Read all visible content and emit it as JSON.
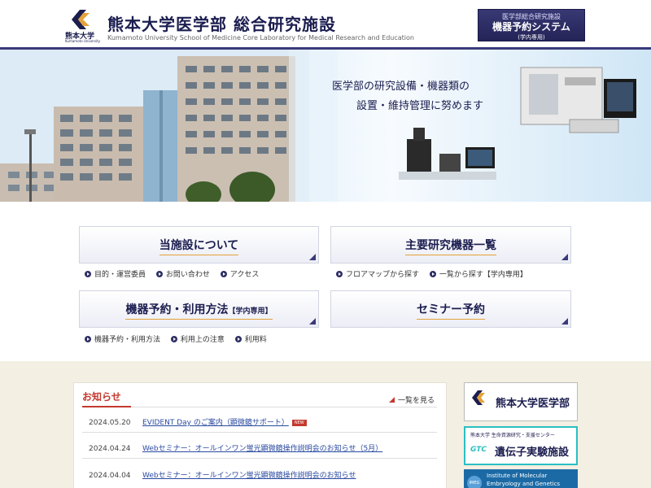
{
  "header": {
    "logo_text": "熊本大学",
    "logo_sub": "Kumamoto University",
    "title_main": "熊本大学医学部",
    "title_strong": "総合研究施設",
    "subtitle": "Kumamoto University School of Medicine Core Laboratory for Medical Research and Education",
    "reserve": {
      "line1": "医学部総合研究施設",
      "line2": "機器予約システム",
      "line3": "(学内専用)"
    }
  },
  "hero": {
    "line1": "医学部の研究設備・機器類の",
    "line2": "設置・維持管理に努めます"
  },
  "panels": [
    {
      "title": "当施設について",
      "tag": "",
      "links": [
        "目的・運営委員",
        "お問い合わせ",
        "アクセス"
      ]
    },
    {
      "title": "主要研究機器一覧",
      "tag": "",
      "links": [
        "フロアマップから探す",
        "一覧から探す【学内専用】"
      ]
    },
    {
      "title": "機器予約・利用方法",
      "tag": "【学内専用】",
      "links": [
        "機器予約・利用方法",
        "利用上の注意",
        "利用料"
      ]
    },
    {
      "title": "セミナー予約",
      "tag": "",
      "links": []
    }
  ],
  "news": {
    "heading": "お知らせ",
    "see_all": "一覧を見る",
    "items": [
      {
        "date": "2024.05.20",
        "title": "EVIDENT Day のご案内（顕微鏡サポート）",
        "badge": "NEW"
      },
      {
        "date": "2024.04.24",
        "title": "Webセミナー：オールインワン蛍光顕微鏡操作説明会のお知らせ（5月）",
        "badge": ""
      },
      {
        "date": "2024.04.04",
        "title": "Webセミナー：オールインワン蛍光顕微鏡操作説明会のお知らせ",
        "badge": ""
      }
    ]
  },
  "banners": {
    "b1": "熊本大学医学部",
    "b2_top": "熊本大学 生命資源研究・支援センター",
    "b2_logo": "GTC",
    "b2_main": "遺伝子実験施設",
    "b3_logo": "IMEG",
    "b3_line1": "Institute of Molecular",
    "b3_line2": "Embryology and Genetics"
  },
  "colors": {
    "navy": "#1b1d4f",
    "accent_red": "#c4392f",
    "lower_bg": "#f3efe2",
    "gtc_teal": "#2bbfc2"
  }
}
